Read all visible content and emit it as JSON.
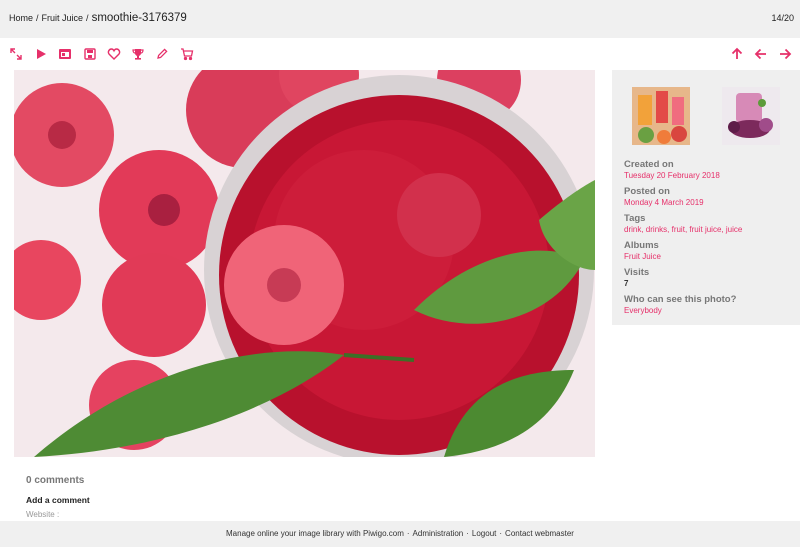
{
  "breadcrumb": {
    "home": "Home",
    "sep": "/",
    "album": "Fruit Juice",
    "title": "smoothie-3176379"
  },
  "counter": "14/20",
  "toolbar": {
    "left_icons": [
      "fullscreen-icon",
      "play-icon",
      "properties-icon",
      "download-icon",
      "heart-icon",
      "trophy-icon",
      "edit-icon",
      "cart-icon"
    ],
    "right_icons": [
      "arrow-up-icon",
      "arrow-left-icon",
      "arrow-right-icon"
    ]
  },
  "accent_color": "#e6306a",
  "info": {
    "created_label": "Created on",
    "created_value": "Tuesday 20 February 2018",
    "posted_label": "Posted on",
    "posted_value": "Monday 4 March 2019",
    "tags_label": "Tags",
    "tags": [
      "drink",
      "drinks",
      "fruit",
      "fruit juice",
      "juice"
    ],
    "albums_label": "Albums",
    "albums_value": "Fruit Juice",
    "visits_label": "Visits",
    "visits_value": "7",
    "who_label": "Who can see this photo?",
    "who_value": "Everybody"
  },
  "comments": {
    "count_text": "0 comments",
    "add_label": "Add a comment",
    "website_label": "Website :"
  },
  "footer": {
    "text1": "Manage online your image library with Piwigo.com",
    "sep": "·",
    "admin": "Administration",
    "logout": "Logout",
    "contact": "Contact webmaster"
  }
}
